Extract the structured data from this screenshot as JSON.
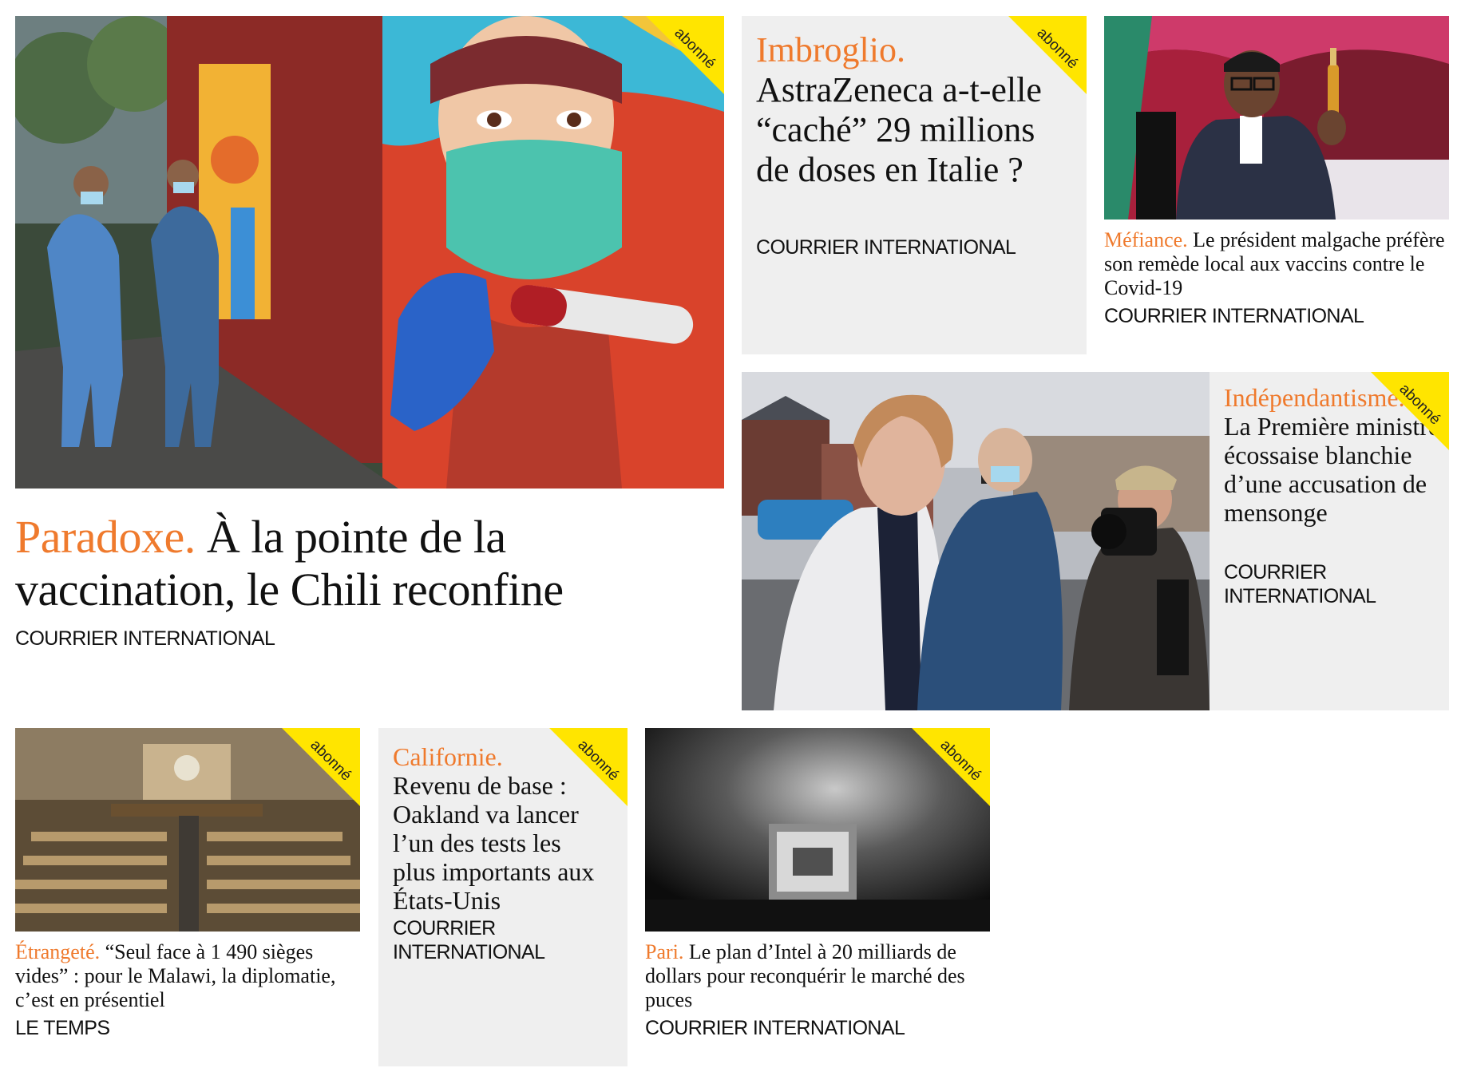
{
  "badge_label": "abonné",
  "colors": {
    "kicker": "#ef7a2d",
    "badge": "#ffe500",
    "card_bg": "#efefef"
  },
  "articles": [
    {
      "kicker": "Paradoxe.",
      "title": "À la pointe de la vaccination, le Chili reconfine",
      "source": "COURRIER INTERNATIONAL",
      "badge": true
    },
    {
      "kicker": "Imbroglio.",
      "title": "AstraZeneca a-t-elle “caché” 29 millions de doses en Italie ?",
      "source": "COURRIER INTERNATIONAL",
      "badge": true
    },
    {
      "kicker": "Méfiance.",
      "title": "Le président malgache préfère son remède local aux vaccins contre le Covid-19",
      "source": "COURRIER INTERNATIONAL",
      "badge": false
    },
    {
      "kicker": "Indépendantisme.",
      "title": "La Première ministre écossaise blanchie d’une accusation de mensonge",
      "source": "COURRIER INTERNATIONAL",
      "badge": true
    },
    {
      "kicker": "Étrangeté.",
      "title": "“Seul face à 1 490 sièges vides” : pour le Malawi, la diplomatie, c’est en présentiel",
      "source": "LE TEMPS",
      "badge": true
    },
    {
      "kicker": "Californie.",
      "title": "Revenu de base : Oakland va lancer l’un des tests les plus importants aux États-Unis",
      "source": "COURRIER INTERNATIONAL",
      "badge": true
    },
    {
      "kicker": "Pari.",
      "title": "Le plan d’Intel à 20 milliards de dollars pour reconquérir le marché des puces",
      "source": "COURRIER INTERNATIONAL",
      "badge": true
    }
  ]
}
